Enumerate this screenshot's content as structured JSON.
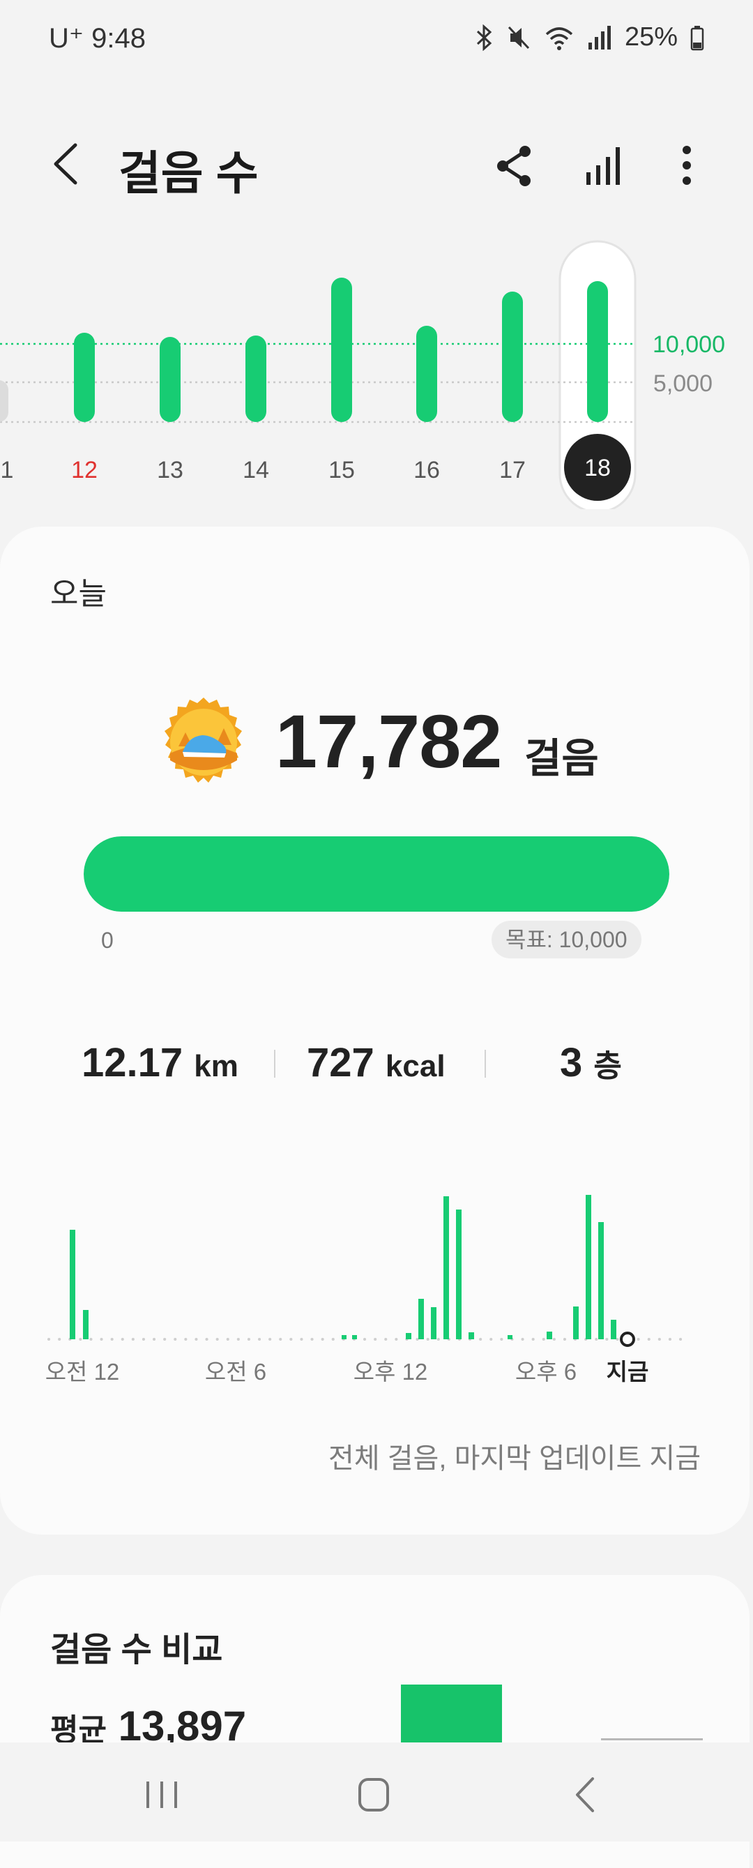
{
  "status": {
    "carrier": "U⁺ 9:48",
    "battery": "25%"
  },
  "header": {
    "title": "걸음 수"
  },
  "weekly": {
    "days": [
      "1",
      "12",
      "13",
      "14",
      "15",
      "16",
      "17",
      "18"
    ],
    "selected": "18",
    "goal_label": "10,000",
    "half_label": "5,000",
    "colors": {
      "bar": "#17cc73",
      "sunday": "#e0322f",
      "selected_bg": "#222222"
    }
  },
  "today": {
    "label": "오늘",
    "steps": "17,782",
    "unit": "걸음",
    "progress_fraction": 1.0,
    "start": "0",
    "goal": "목표: 10,000",
    "distance": {
      "value": "12.17",
      "unit": "km"
    },
    "calories": {
      "value": "727",
      "unit": "kcal"
    },
    "floors": {
      "value": "3",
      "unit": "층"
    }
  },
  "hourly": {
    "labels": [
      "오전 12",
      "오전 6",
      "오후 12",
      "오후 6",
      "지금"
    ],
    "update_text": "전체 걸음, 마지막 업데이트 지금"
  },
  "compare": {
    "title": "걸음 수 비교",
    "avg_label": "평균",
    "avg_value": "13,897"
  },
  "colors": {
    "accent": "#17cc73",
    "background": "#f3f3f3",
    "card": "#fbfbfb"
  }
}
